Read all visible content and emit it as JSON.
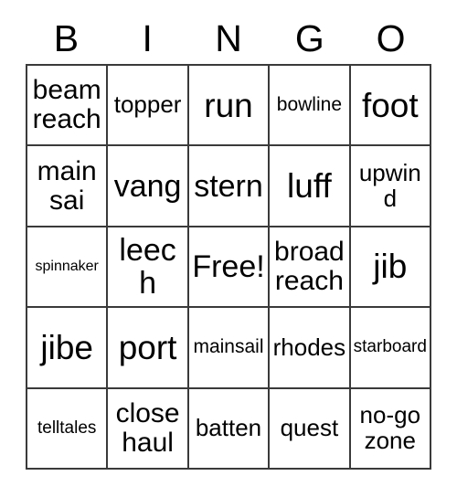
{
  "card": {
    "title_letters": [
      "B",
      "I",
      "N",
      "G",
      "O"
    ],
    "colors": {
      "border": "#3a3a3a",
      "text": "#000000",
      "background": "#ffffff"
    },
    "rows": [
      [
        {
          "text": "beam reach",
          "size": "lg"
        },
        {
          "text": "topper",
          "size": "md"
        },
        {
          "text": "run",
          "size": "xxl"
        },
        {
          "text": "bowline",
          "size": "sm"
        },
        {
          "text": "foot",
          "size": "xxl"
        }
      ],
      [
        {
          "text": "main sai",
          "size": "lg"
        },
        {
          "text": "vang",
          "size": "xl"
        },
        {
          "text": "stern",
          "size": "xl"
        },
        {
          "text": "luff",
          "size": "xxl"
        },
        {
          "text": "upwind",
          "size": "md"
        }
      ],
      [
        {
          "text": "spinnaker",
          "size": "xxs"
        },
        {
          "text": "leech",
          "size": "xl"
        },
        {
          "text": "Free!",
          "size": "xl"
        },
        {
          "text": "broad reach",
          "size": "lg"
        },
        {
          "text": "jib",
          "size": "xxl"
        }
      ],
      [
        {
          "text": "jibe",
          "size": "xxl"
        },
        {
          "text": "port",
          "size": "xxl"
        },
        {
          "text": "mainsail",
          "size": "sm"
        },
        {
          "text": "rhodes",
          "size": "md"
        },
        {
          "text": "starboard",
          "size": "xs"
        }
      ],
      [
        {
          "text": "telltales",
          "size": "xs"
        },
        {
          "text": "close haul",
          "size": "lg"
        },
        {
          "text": "batten",
          "size": "md"
        },
        {
          "text": "quest",
          "size": "md"
        },
        {
          "text": "no-go zone",
          "size": "md"
        }
      ]
    ]
  }
}
